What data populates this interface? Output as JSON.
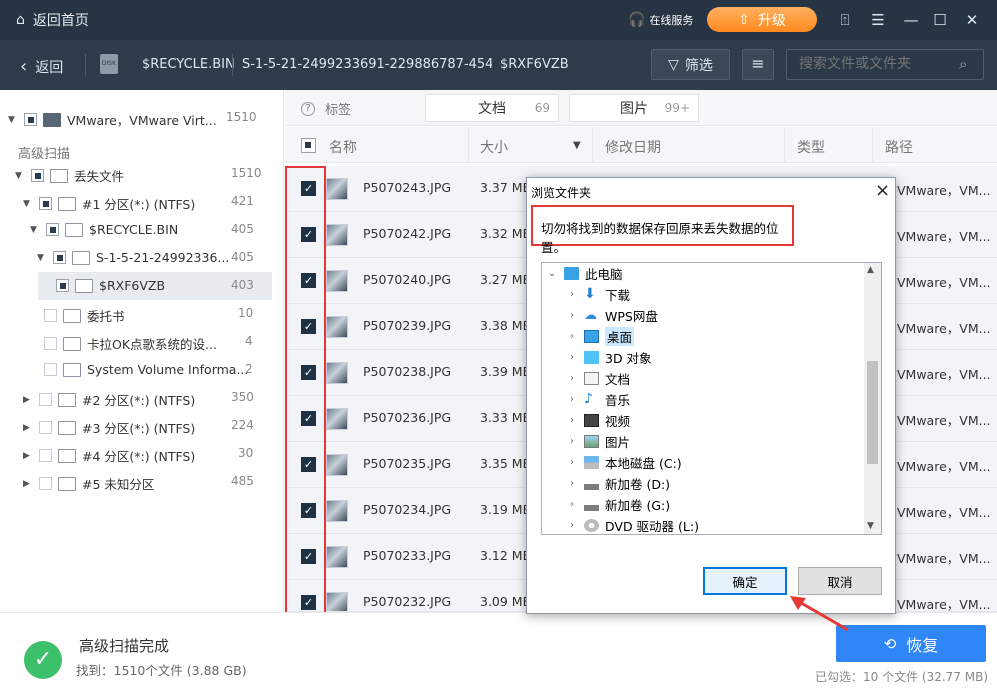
{
  "titlebar": {
    "home_label": "返回首页",
    "service_label": "在线服务",
    "upgrade_label": "升级"
  },
  "toolbar": {
    "back_label": "返回",
    "breadcrumb": [
      "$RECYCLE.BIN",
      "S-1-5-21-2499233691-229886787-454925...",
      "$RXF6VZB"
    ],
    "filter_label": "筛选",
    "search_placeholder": "搜索文件或文件夹"
  },
  "sidebar": {
    "root_label": "VMware，VMware Virt...",
    "root_count": "1510",
    "section_label": "高级扫描",
    "items": [
      {
        "label": "丢失文件",
        "count": "1510"
      },
      {
        "label": "#1 分区(*:) (NTFS)",
        "count": "421"
      },
      {
        "label": "$RECYCLE.BIN",
        "count": "405"
      },
      {
        "label": "S-1-5-21-24992336...",
        "count": "405"
      },
      {
        "label": "$RXF6VZB",
        "count": "403"
      },
      {
        "label": "委托书",
        "count": "10"
      },
      {
        "label": "卡拉OK点歌系统的设...",
        "count": "4"
      },
      {
        "label": "System Volume Informa...",
        "count": "2"
      },
      {
        "label": "#2 分区(*:) (NTFS)",
        "count": "350"
      },
      {
        "label": "#3 分区(*:) (NTFS)",
        "count": "224"
      },
      {
        "label": "#4 分区(*:) (NTFS)",
        "count": "30"
      },
      {
        "label": "#5 未知分区",
        "count": "485"
      }
    ]
  },
  "tabs": {
    "tag_label": "标签",
    "docs_label": "文档",
    "docs_count": "69",
    "pics_label": "图片",
    "pics_count": "99+"
  },
  "table": {
    "headers": {
      "name": "名称",
      "size": "大小",
      "date": "修改日期",
      "type": "类型",
      "path": "路径"
    },
    "rows": [
      {
        "name": "P5070243.JPG",
        "size": "3.37 MB",
        "path": "VMware，VM..."
      },
      {
        "name": "P5070242.JPG",
        "size": "3.32 MB",
        "path": "VMware，VM..."
      },
      {
        "name": "P5070240.JPG",
        "size": "3.27 MB",
        "path": "VMware，VM..."
      },
      {
        "name": "P5070239.JPG",
        "size": "3.38 MB",
        "path": "VMware，VM..."
      },
      {
        "name": "P5070238.JPG",
        "size": "3.39 MB",
        "path": "VMware，VM..."
      },
      {
        "name": "P5070236.JPG",
        "size": "3.33 MB",
        "path": "VMware，VM..."
      },
      {
        "name": "P5070235.JPG",
        "size": "3.35 MB",
        "path": "VMware，VM..."
      },
      {
        "name": "P5070234.JPG",
        "size": "3.19 MB",
        "path": "VMware，VM..."
      },
      {
        "name": "P5070233.JPG",
        "size": "3.12 MB",
        "path": "VMware，VM..."
      },
      {
        "name": "P5070232.JPG",
        "size": "3.09 MB",
        "path": "VMware，VM..."
      }
    ]
  },
  "bottom": {
    "status_title": "高级扫描完成",
    "found_text": "找到：1510个文件 (3.88 GB)",
    "recover_label": "恢复",
    "selected_text": "已勾选：10 个文件 (32.77 MB)"
  },
  "dialog": {
    "title": "浏览文件夹",
    "message": "切勿将找到的数据保存回原来丢失数据的位置。",
    "tree": [
      {
        "label": "此电脑",
        "icon": "pc-icon"
      },
      {
        "label": "下载",
        "icon": "download-icon"
      },
      {
        "label": "WPS网盘",
        "icon": "cloud-icon"
      },
      {
        "label": "桌面",
        "icon": "desktop-icon"
      },
      {
        "label": "3D 对象",
        "icon": "cube-icon"
      },
      {
        "label": "文档",
        "icon": "document-icon"
      },
      {
        "label": "音乐",
        "icon": "music-icon"
      },
      {
        "label": "视频",
        "icon": "video-icon"
      },
      {
        "label": "图片",
        "icon": "picture-icon"
      },
      {
        "label": "本地磁盘 (C:)",
        "icon": "disk-icon"
      },
      {
        "label": "新加卷 (D:)",
        "icon": "drive-icon"
      },
      {
        "label": "新加卷 (G:)",
        "icon": "drive-icon"
      },
      {
        "label": "DVD 驱动器 (L:)",
        "icon": "dvd-icon"
      }
    ],
    "ok_label": "确定",
    "cancel_label": "取消"
  }
}
